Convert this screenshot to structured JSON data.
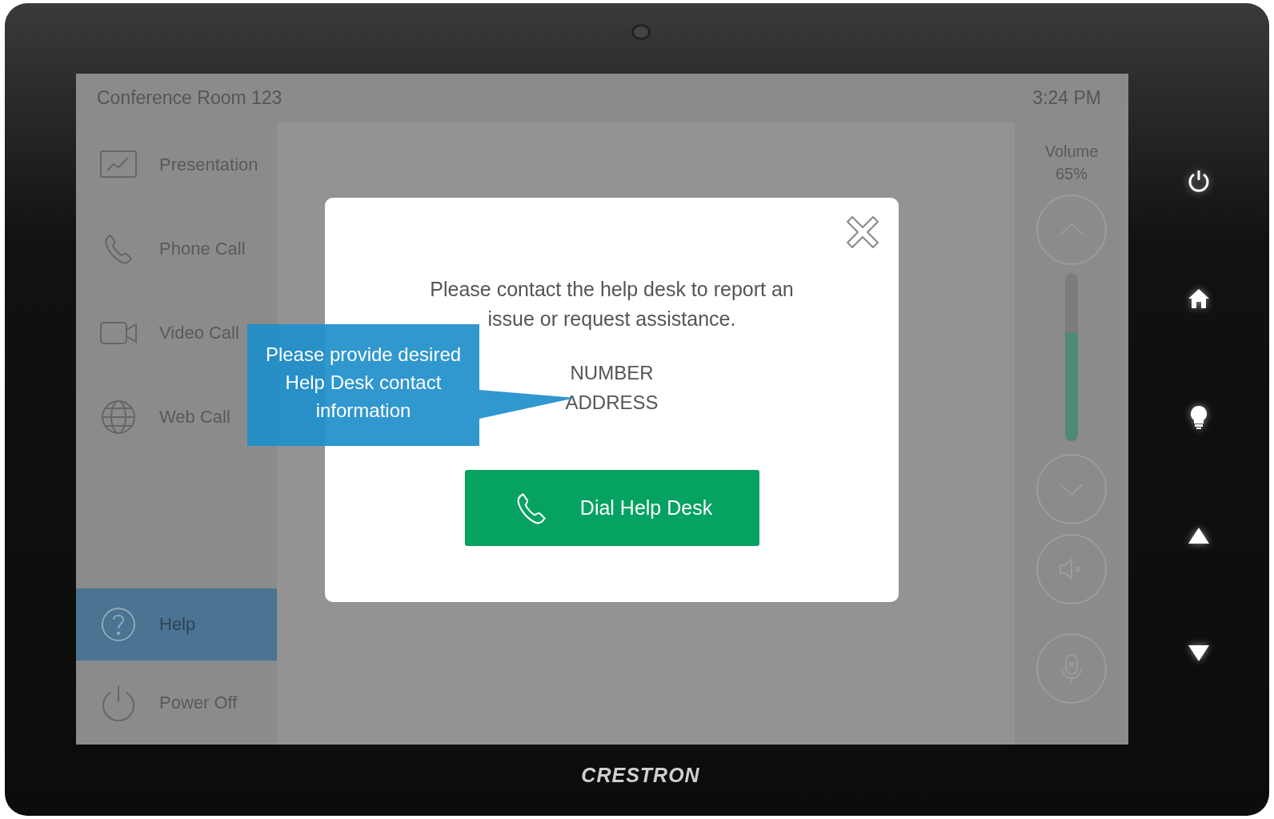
{
  "screen": {
    "room_name": "Conference Room 123",
    "clock": "3:24 PM"
  },
  "sidebar": {
    "items": [
      {
        "kind": "presentation",
        "label": "Presentation",
        "selected": false
      },
      {
        "kind": "phone",
        "label": "Phone Call",
        "selected": false
      },
      {
        "kind": "video",
        "label": "Video Call",
        "selected": false
      },
      {
        "kind": "web",
        "label": "Web Call",
        "selected": false
      },
      {
        "kind": "help",
        "label": "Help",
        "selected": true
      },
      {
        "kind": "power",
        "label": "Power Off",
        "selected": false
      }
    ]
  },
  "volume": {
    "label": "Volume",
    "reading": "65%",
    "level": 0.65
  },
  "dialog": {
    "message": "Please contact the help desk to report an issue or request assistance.",
    "contact_lines": [
      "NUMBER",
      "ADDRESS"
    ],
    "button": "Dial Help Desk"
  },
  "callout": {
    "text": "Please provide desired Help Desk contact information"
  },
  "hardware_buttons": [
    {
      "kind": "power"
    },
    {
      "kind": "home"
    },
    {
      "kind": "light"
    },
    {
      "kind": "up"
    },
    {
      "kind": "down"
    }
  ],
  "brand": "CRESTRON"
}
